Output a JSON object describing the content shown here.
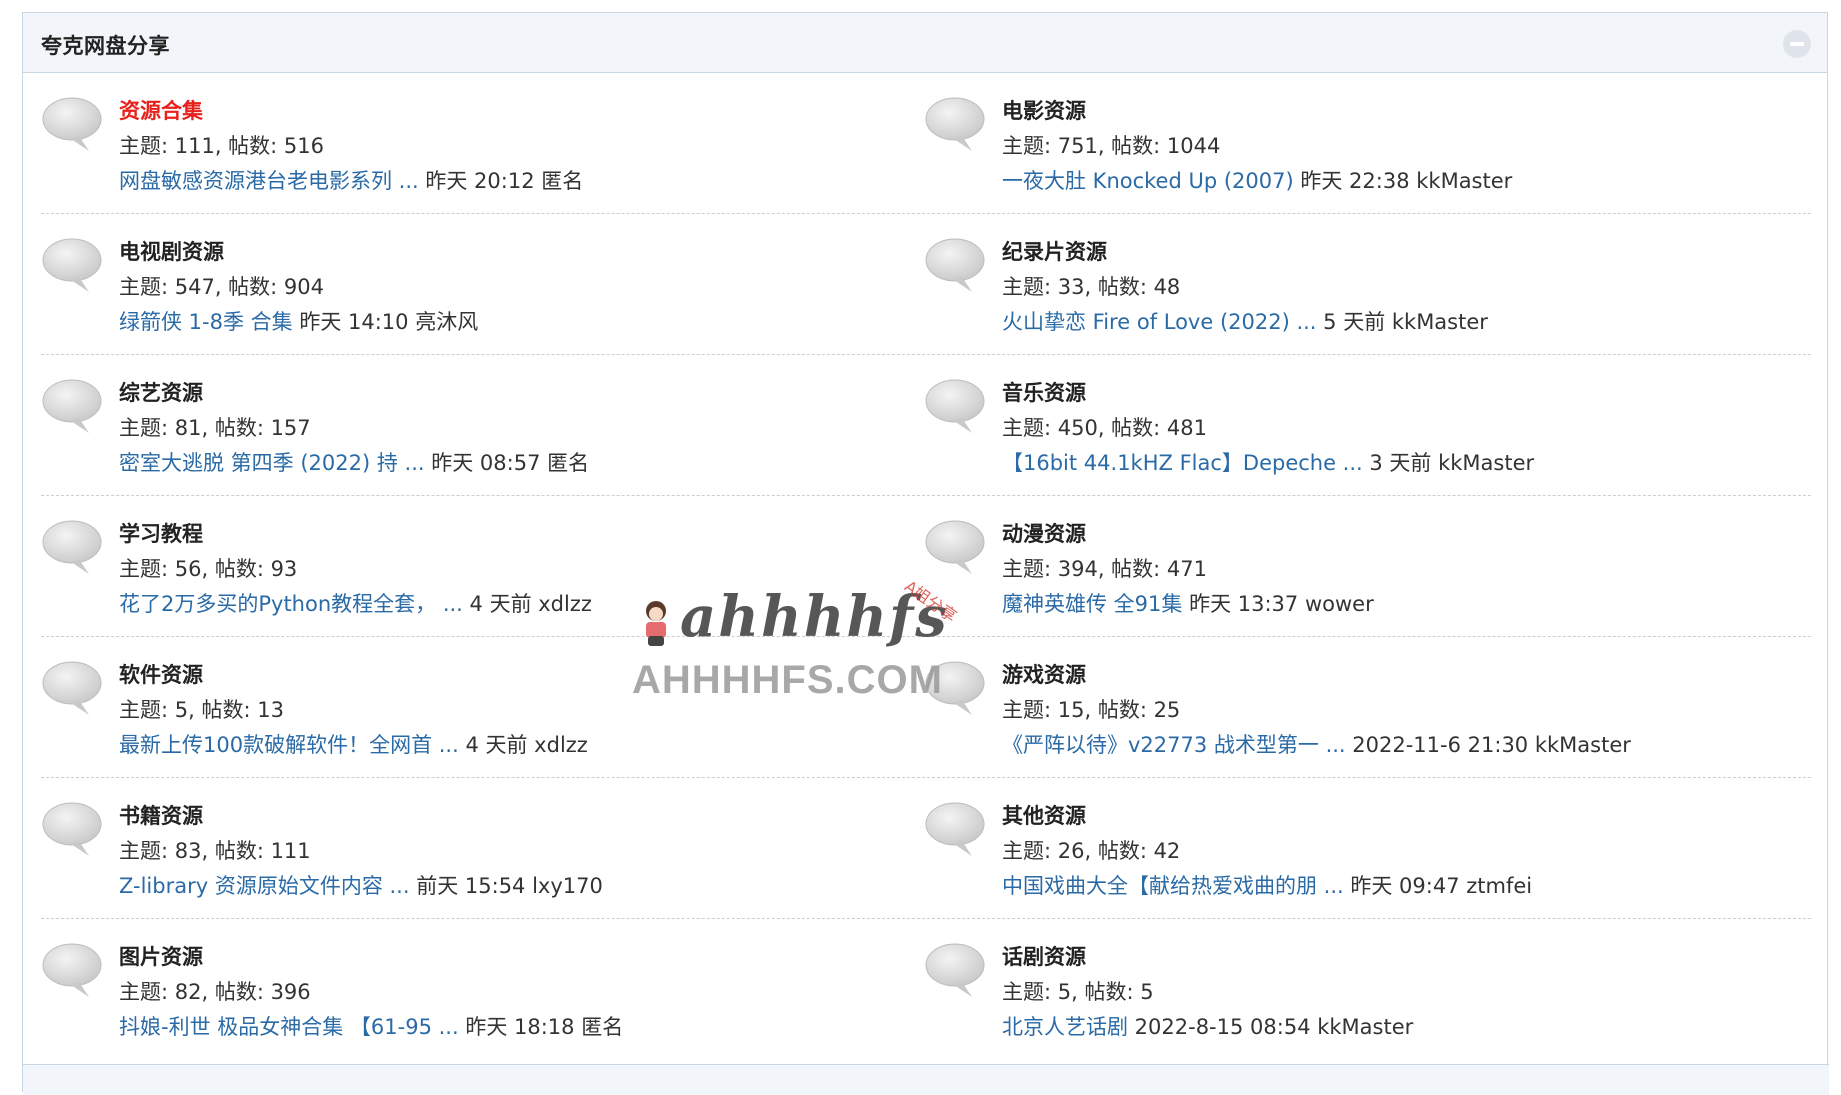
{
  "section": {
    "title": "夸克网盘分享"
  },
  "forums": [
    {
      "name": "资源合集",
      "highlight": true,
      "stats": "主题: 111, 帖数: 516",
      "last_post_title": "网盘敏感资源港台老电影系列 ...",
      "last_post_meta": " 昨天 20:12 匿名"
    },
    {
      "name": "电影资源",
      "highlight": false,
      "stats": "主题: 751, 帖数: 1044",
      "last_post_title": "一夜大肚 Knocked Up (2007)",
      "last_post_meta": " 昨天 22:38 kkMaster"
    },
    {
      "name": "电视剧资源",
      "highlight": false,
      "stats": "主题: 547, 帖数: 904",
      "last_post_title": "绿箭侠 1-8季 合集",
      "last_post_meta": " 昨天 14:10 亮沐风"
    },
    {
      "name": "纪录片资源",
      "highlight": false,
      "stats": "主题: 33, 帖数: 48",
      "last_post_title": "火山挚恋 Fire of Love (2022) ...",
      "last_post_meta": " 5 天前 kkMaster"
    },
    {
      "name": "综艺资源",
      "highlight": false,
      "stats": "主题: 81, 帖数: 157",
      "last_post_title": "密室大逃脱 第四季 (2022) 持 ...",
      "last_post_meta": " 昨天 08:57 匿名"
    },
    {
      "name": "音乐资源",
      "highlight": false,
      "stats": "主题: 450, 帖数: 481",
      "last_post_title": "【16bit 44.1kHZ Flac】Depeche ...",
      "last_post_meta": " 3 天前 kkMaster"
    },
    {
      "name": "学习教程",
      "highlight": false,
      "stats": "主题: 56, 帖数: 93",
      "last_post_title": "花了2万多买的Python教程全套，  ...",
      "last_post_meta": " 4 天前 xdlzz"
    },
    {
      "name": "动漫资源",
      "highlight": false,
      "stats": "主题: 394, 帖数: 471",
      "last_post_title": "魔神英雄传 全91集",
      "last_post_meta": " 昨天 13:37 wower"
    },
    {
      "name": "软件资源",
      "highlight": false,
      "stats": "主题: 5, 帖数: 13",
      "last_post_title": "最新上传100款破解软件！全网首 ...",
      "last_post_meta": " 4 天前 xdlzz"
    },
    {
      "name": "游戏资源",
      "highlight": false,
      "stats": "主题: 15, 帖数: 25",
      "last_post_title": "《严阵以待》v22773 战术型第一 ...",
      "last_post_meta": " 2022-11-6 21:30 kkMaster"
    },
    {
      "name": "书籍资源",
      "highlight": false,
      "stats": "主题: 83, 帖数: 111",
      "last_post_title": "Z-library 资源原始文件内容 ...",
      "last_post_meta": " 前天 15:54 lxy170"
    },
    {
      "name": "其他资源",
      "highlight": false,
      "stats": "主题: 26, 帖数: 42",
      "last_post_title": "中国戏曲大全【献给热爱戏曲的朋 ...",
      "last_post_meta": " 昨天 09:47 ztmfei"
    },
    {
      "name": "图片资源",
      "highlight": false,
      "stats": "主题: 82, 帖数: 396",
      "last_post_title": "抖娘-利世 极品女神合集 【61-95 ...",
      "last_post_meta": " 昨天 18:18 匿名"
    },
    {
      "name": "话剧资源",
      "highlight": false,
      "stats": "主题: 5, 帖数: 5",
      "last_post_title": "北京人艺话剧",
      "last_post_meta": " 2022-8-15 08:54 kkMaster"
    }
  ],
  "watermark": {
    "script_text": "ahhhhfs",
    "tag_text": "A姐分享",
    "domain_text": "AHHHHFS.COM"
  },
  "colors": {
    "link": "#2a6aa6",
    "highlight": "#e8211c",
    "header_bg": "#f2f6fa",
    "border": "#c9d6e3"
  },
  "icons": {
    "forum": "speech-bubble-icon",
    "collapse": "collapse-icon"
  }
}
